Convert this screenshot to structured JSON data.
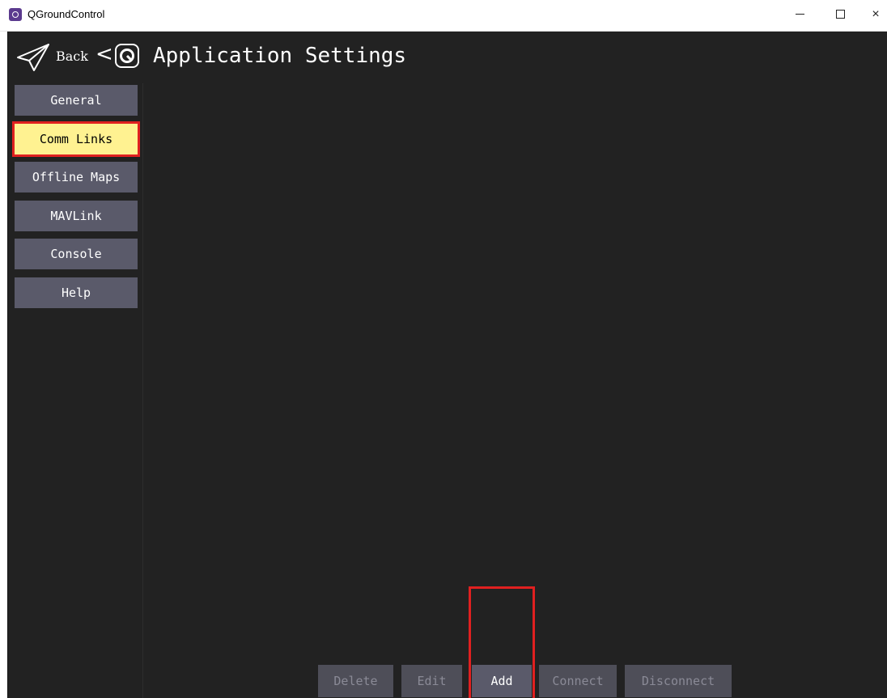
{
  "window": {
    "title": "QGroundControl",
    "minimize_icon": "minimize-icon",
    "maximize_icon": "maximize-icon",
    "close_glyph": "×"
  },
  "header": {
    "back_label": "Back",
    "chevron_glyph": "<",
    "title": "Application Settings"
  },
  "sidebar": {
    "items": [
      {
        "label": "General",
        "active": false
      },
      {
        "label": "Comm Links",
        "active": true
      },
      {
        "label": "Offline Maps",
        "active": false
      },
      {
        "label": "MAVLink",
        "active": false
      },
      {
        "label": "Console",
        "active": false
      },
      {
        "label": "Help",
        "active": false
      }
    ]
  },
  "actions": {
    "delete": "Delete",
    "edit": "Edit",
    "add": "Add",
    "connect": "Connect",
    "disconnect": "Disconnect"
  },
  "colors": {
    "background": "#222222",
    "button": "#5a5a6a",
    "active": "#fff291",
    "highlight": "#e02020"
  }
}
